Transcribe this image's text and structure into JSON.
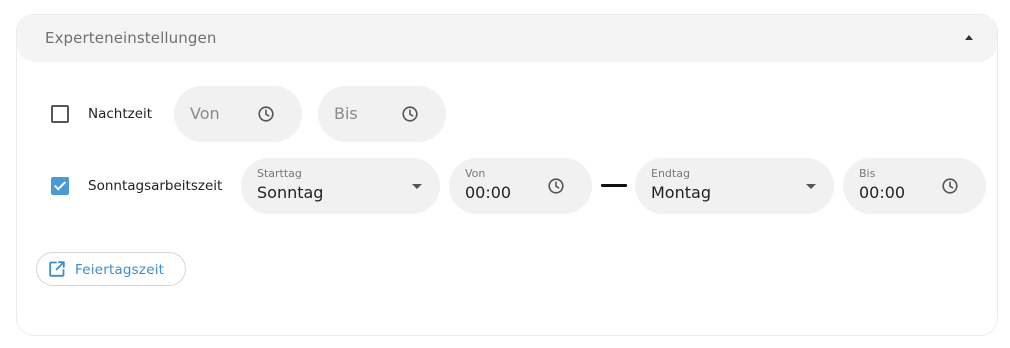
{
  "panel": {
    "title": "Experteneinstellungen",
    "expanded": true
  },
  "night": {
    "label": "Nachtzeit",
    "checked": false,
    "from_placeholder": "Von",
    "to_placeholder": "Bis"
  },
  "sunday": {
    "label": "Sonntagsarbeitszeit",
    "checked": true,
    "start_day": {
      "label": "Starttag",
      "value": "Sonntag"
    },
    "from": {
      "label": "Von",
      "value": "00:00"
    },
    "end_day": {
      "label": "Endtag",
      "value": "Montag"
    },
    "to": {
      "label": "Bis",
      "value": "00:00"
    }
  },
  "holiday_button": {
    "label": "Feiertagszeit",
    "icon": "external-link-icon"
  },
  "colors": {
    "accent": "#4a9ad6",
    "link": "#3a8fd0",
    "field_bg": "#f1f1f1",
    "header_bg": "#f4f4f4"
  }
}
